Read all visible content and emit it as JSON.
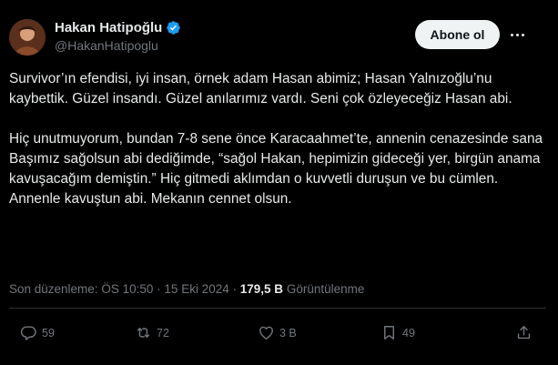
{
  "author": {
    "display_name": "Hakan Hatipoğlu",
    "handle": "@HakanHatipoglu",
    "verified_color": "#1d9bf0"
  },
  "follow_button": {
    "label": "Abone ol"
  },
  "tweet": {
    "paragraphs": [
      "Survivor’ın efendisi, iyi insan, örnek adam Hasan abimiz; Hasan Yalnızoğlu’nu kaybettik. Güzel insandı. Güzel anılarımız vardı. Seni çok özleyeceğiz Hasan abi.",
      "Hiç unutmuyorum, bundan 7-8 sene önce Karacaahmet’te, annenin cenazesinde sana Başımız sağolsun abi dediğimde, “sağol Hakan, hepimizin gideceği yer, birgün anama kavuşacağım demiştin.” Hiç gitmedi aklımdan o kuvvetli duruşun ve bu cümlen. Annenle kavuştun abi. Mekanın cennet olsun."
    ]
  },
  "meta": {
    "edited_label": "Son düzenleme:",
    "time": "ÖS 10:50",
    "separator": "·",
    "date": "15 Eki 2024",
    "views_count": "179,5 B",
    "views_label": "Görüntülenme"
  },
  "actions": {
    "replies": "59",
    "reposts": "72",
    "likes": "3 B",
    "bookmarks": "49"
  }
}
